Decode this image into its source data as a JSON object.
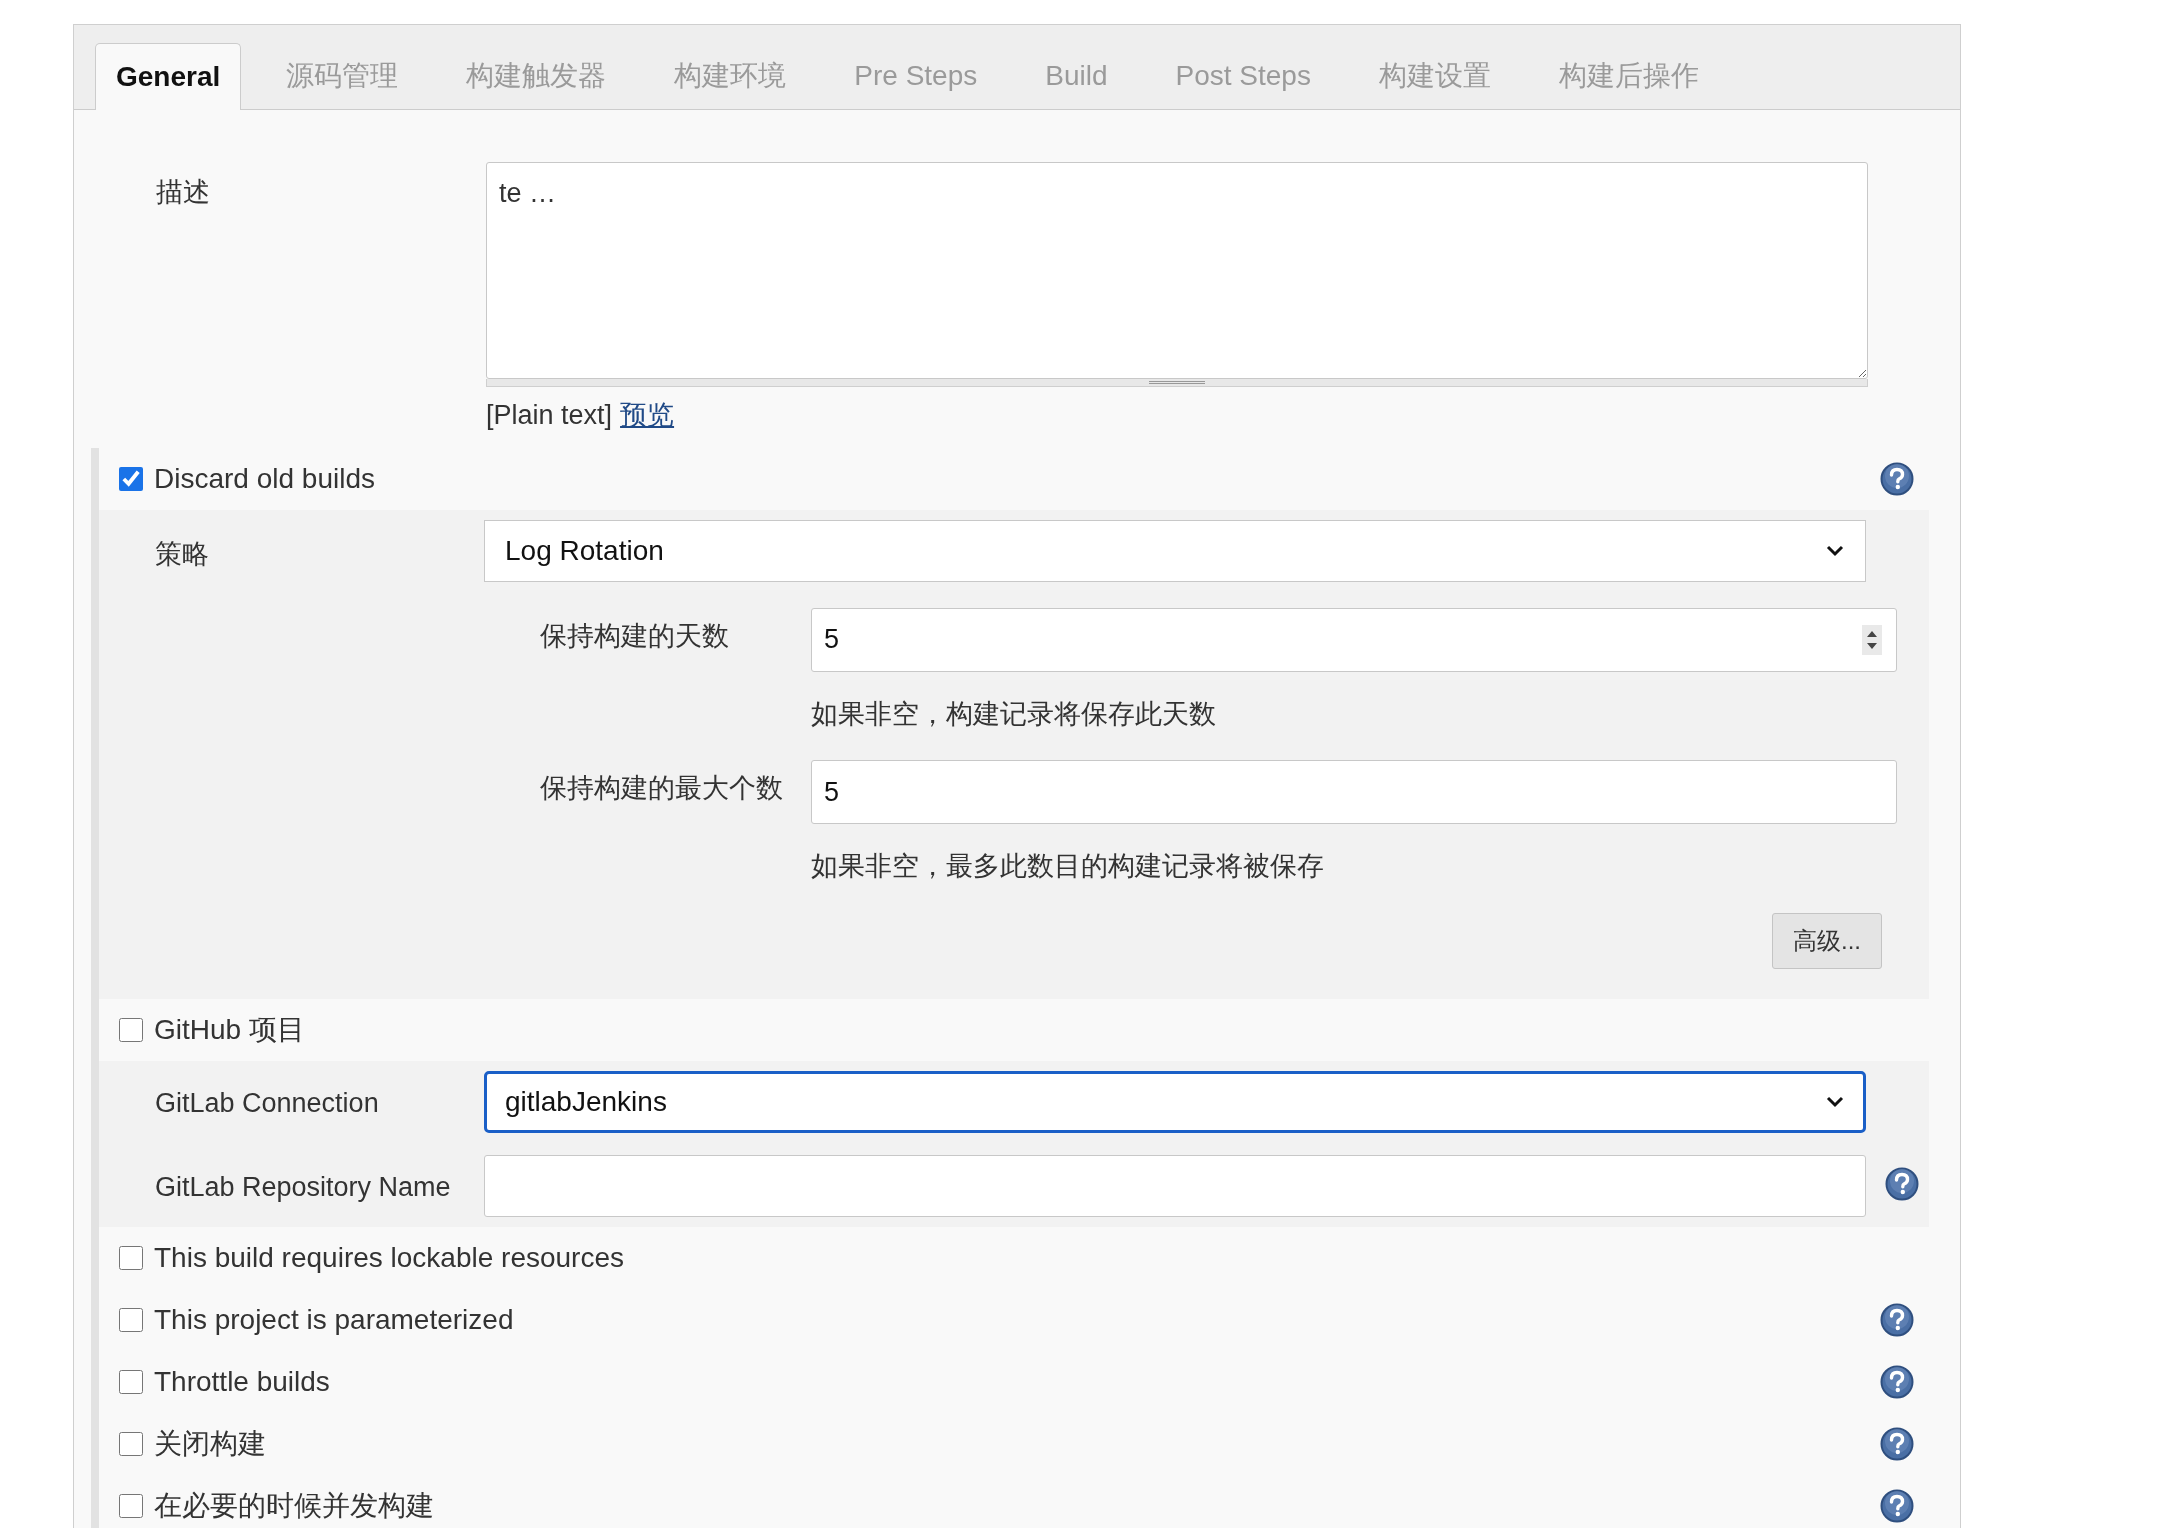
{
  "tabs": [
    {
      "label": "General",
      "selected": true
    },
    {
      "label": "源码管理",
      "selected": false
    },
    {
      "label": "构建触发器",
      "selected": false
    },
    {
      "label": "构建环境",
      "selected": false
    },
    {
      "label": "Pre Steps",
      "selected": false
    },
    {
      "label": "Build",
      "selected": false
    },
    {
      "label": "Post Steps",
      "selected": false
    },
    {
      "label": "构建设置",
      "selected": false
    },
    {
      "label": "构建后操作",
      "selected": false
    }
  ],
  "description": {
    "label": "描述",
    "value": "te …",
    "format": "[Plain text]",
    "preview_link": "预览"
  },
  "discard_old_builds": {
    "label": "Discard old builds",
    "checked": true,
    "strategy": {
      "label": "策略",
      "value": "Log Rotation"
    },
    "fields": [
      {
        "label": "保持构建的天数",
        "value": "5",
        "kind": "number",
        "hint": "如果非空，构建记录将保存此天数"
      },
      {
        "label": "保持构建的最大个数",
        "value": "5",
        "kind": "text",
        "hint": "如果非空，最多此数目的构建记录将被保存"
      }
    ],
    "advanced_button": "高级..."
  },
  "github_project": {
    "label": "GitHub 项目",
    "checked": false
  },
  "gitlab": {
    "connection": {
      "label": "GitLab Connection",
      "value": "gitlabJenkins",
      "focused": true
    },
    "repository": {
      "label": "GitLab Repository Name"
    }
  },
  "options": [
    {
      "label": "This build requires lockable resources",
      "checked": false,
      "help": false
    },
    {
      "label": "This project is parameterized",
      "checked": false,
      "help": true
    },
    {
      "label": "Throttle builds",
      "checked": false,
      "help": true
    },
    {
      "label": "关闭构建",
      "checked": false,
      "help": true
    },
    {
      "label": "在必要的时候并发构建",
      "checked": false,
      "help": true
    }
  ]
}
